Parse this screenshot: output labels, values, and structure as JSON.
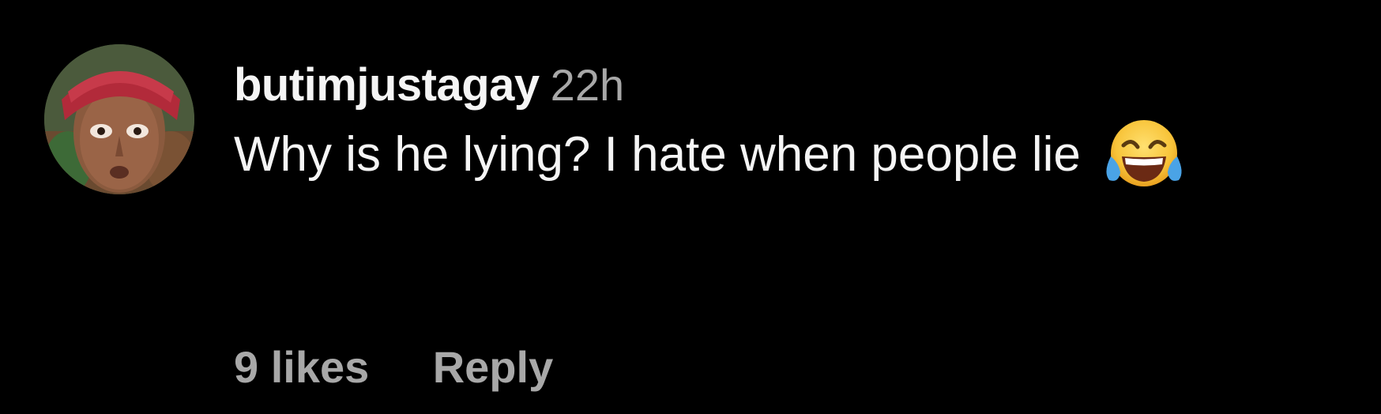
{
  "comment": {
    "username": "butimjustagay",
    "timestamp": "22h",
    "text": "Why is he lying? I hate when people lie",
    "emoji": "face-with-tears-of-joy",
    "likes_label": "9 likes",
    "reply_label": "Reply"
  },
  "colors": {
    "background": "#000000",
    "primary_text": "#f5f5f5",
    "secondary_text": "#a8a8a8"
  }
}
